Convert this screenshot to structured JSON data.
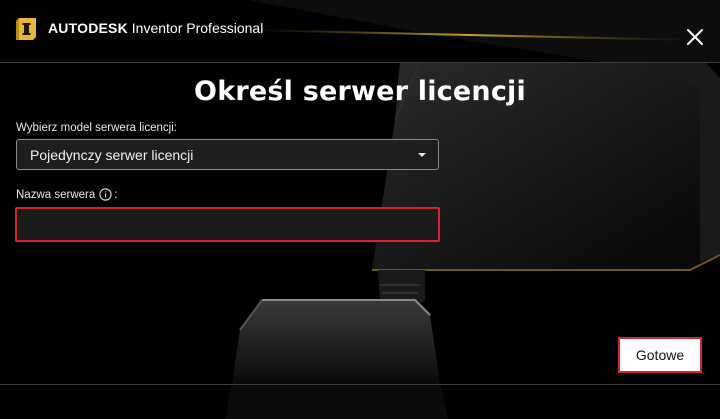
{
  "app": {
    "brand_name": "AUTODESK",
    "product_name": "Inventor Professional",
    "logo_letter": "I",
    "logo_color": "#e7b63a"
  },
  "dialog": {
    "title": "Określ serwer licencji",
    "model_label": "Wybierz model serwera licencji:",
    "model_value": "Pojedynczy serwer licencji",
    "server_label": "Nazwa serwera",
    "server_label_suffix": ":",
    "server_value": "",
    "done_label": "Gotowe"
  },
  "colors": {
    "accent_red": "#d9222e",
    "background": "#000000",
    "gold_highlight": "#c9a227"
  },
  "icons": {
    "close": "close-icon",
    "info": "info-icon",
    "dropdown": "chevron-down-icon",
    "logo": "inventor-logo-icon"
  }
}
